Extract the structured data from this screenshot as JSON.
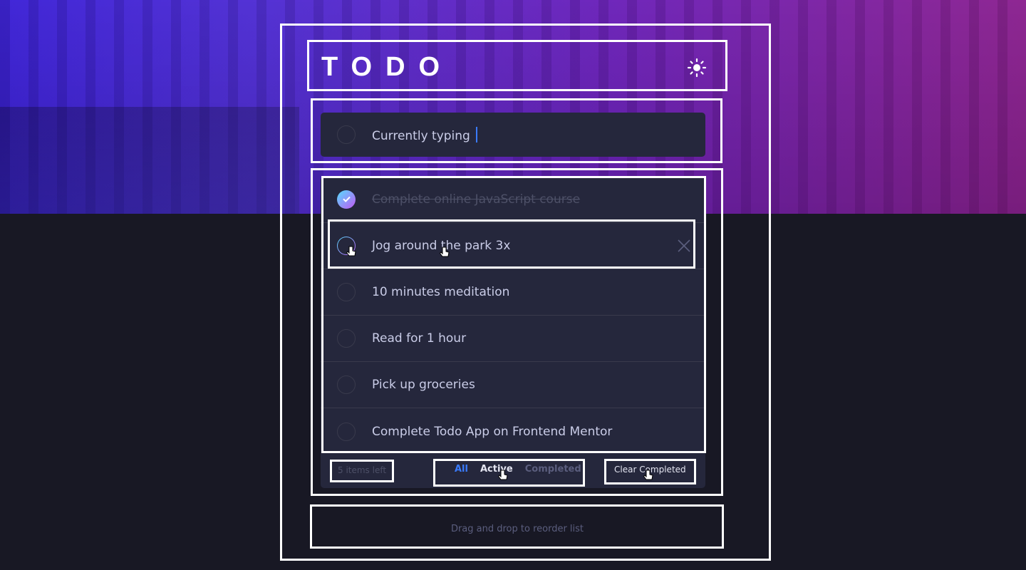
{
  "app": {
    "title": "TODO",
    "theme_toggle_icon": "sun-icon"
  },
  "new_todo": {
    "value": "Currently typing",
    "checkbox_icon": "empty-circle-icon"
  },
  "todos": [
    {
      "label": "Complete online JavaScript course",
      "completed": true
    },
    {
      "label": "Jog around the park 3x",
      "completed": false,
      "hovered": true
    },
    {
      "label": "10 minutes meditation",
      "completed": false
    },
    {
      "label": "Read for 1 hour",
      "completed": false
    },
    {
      "label": "Pick up groceries",
      "completed": false
    },
    {
      "label": "Complete Todo App on Frontend Mentor",
      "completed": false
    }
  ],
  "footer": {
    "items_left": "5 items left",
    "filters": [
      "All",
      "Active",
      "Completed"
    ],
    "selected_filter": "All",
    "clear_label": "Clear Completed"
  },
  "hint": "Drag and drop to reorder list",
  "colors": {
    "accent": "#3a7bfd",
    "check_gradient_start": "#57ddff",
    "check_gradient_end": "#c058f3",
    "card_bg": "#25273c",
    "page_bg": "#181824"
  }
}
